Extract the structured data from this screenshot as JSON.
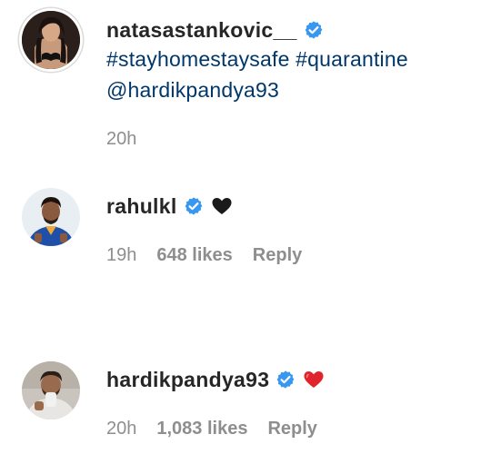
{
  "comments": [
    {
      "username": "natasastankovic__",
      "verified": true,
      "text_parts": [
        "#stayhomestaysafe",
        "#quarantine",
        "@hardikpandya93"
      ],
      "time": "20h",
      "likes": "",
      "reply": "",
      "avatar_icon": "profile-photo-natasa"
    },
    {
      "username": "rahulkl",
      "verified": true,
      "emoji": "black-heart-icon",
      "time": "19h",
      "likes": "648 likes",
      "reply": "Reply",
      "avatar_icon": "profile-photo-rahulkl"
    },
    {
      "username": "hardikpandya93",
      "verified": true,
      "emoji": "red-heart-icon",
      "time": "20h",
      "likes": "1,083 likes",
      "reply": "Reply",
      "avatar_icon": "profile-photo-hardik"
    }
  ],
  "colors": {
    "verified_blue": "#3897f0",
    "link_blue": "#00376b",
    "meta_gray": "#8e8e8e",
    "heart_red": "#e0242b",
    "text_dark": "#262626"
  }
}
